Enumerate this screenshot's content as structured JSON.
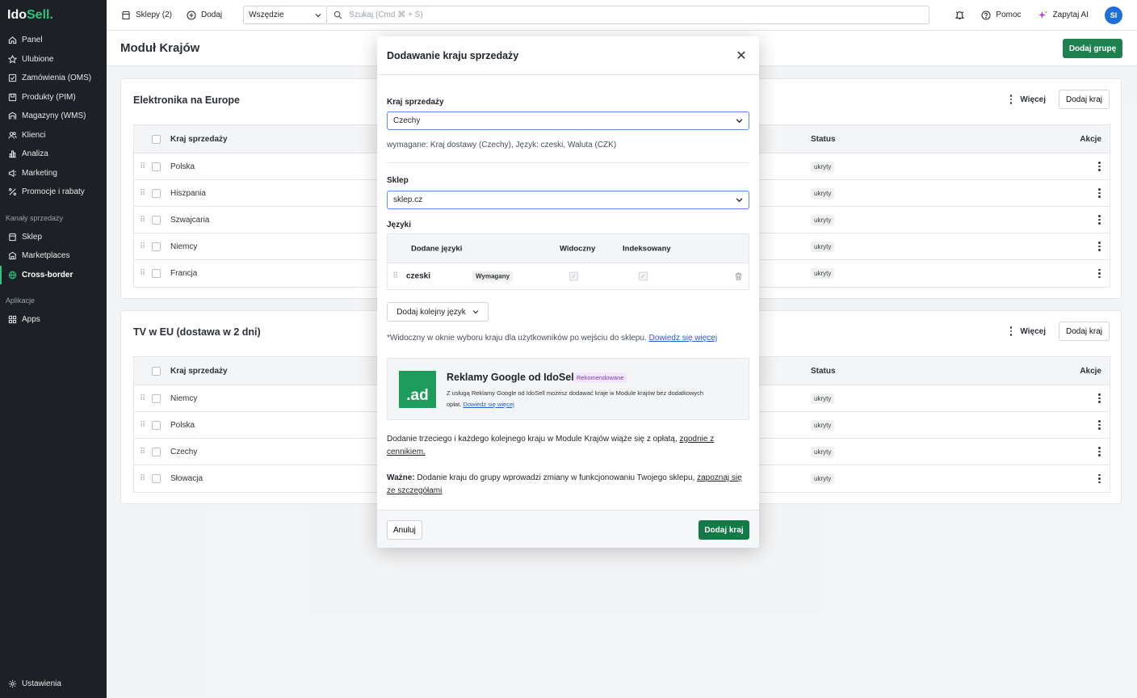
{
  "app": {
    "logo_part1": "Ido",
    "logo_part2": "Sell."
  },
  "sidebar": {
    "items": [
      {
        "label": "Panel",
        "icon": "home-icon"
      },
      {
        "label": "Ulubione",
        "icon": "star-icon"
      },
      {
        "label": "Zamówienia (OMS)",
        "icon": "orders-icon"
      },
      {
        "label": "Produkty (PIM)",
        "icon": "products-icon"
      },
      {
        "label": "Magazyny (WMS)",
        "icon": "warehouse-icon"
      },
      {
        "label": "Klienci",
        "icon": "users-icon"
      },
      {
        "label": "Analiza",
        "icon": "chart-icon"
      },
      {
        "label": "Marketing",
        "icon": "megaphone-icon"
      },
      {
        "label": "Promocje i rabaty",
        "icon": "percent-icon"
      }
    ],
    "section_sales": "Kanały sprzedaży",
    "sales_items": [
      {
        "label": "Sklep",
        "icon": "shop-icon"
      },
      {
        "label": "Marketplaces",
        "icon": "marketplace-icon"
      },
      {
        "label": "Cross-border",
        "icon": "globe-icon",
        "active": true
      }
    ],
    "section_apps": "Aplikacje",
    "apps_items": [
      {
        "label": "Apps",
        "icon": "apps-icon"
      }
    ],
    "settings": "Ustawienia"
  },
  "topbar": {
    "shops": "Sklepy (2)",
    "add": "Dodaj",
    "scope": "Wszędzie",
    "search_placeholder": "Szukaj (Cmd ⌘ + S)",
    "help": "Pomoc",
    "ask_ai": "Zapytaj AI",
    "avatar": "SI"
  },
  "page": {
    "title": "Moduł Krajów",
    "add_group": "Dodaj grupę"
  },
  "groups": [
    {
      "title": "Elektronika na Europe",
      "more": "Więcej",
      "add_country": "Dodaj kraj",
      "col_country": "Kraj sprzedaży",
      "col_status": "Status",
      "col_actions": "Akcje",
      "rows": [
        {
          "name": "Polska",
          "status": "ukryty"
        },
        {
          "name": "Hiszpania",
          "status": "ukryty"
        },
        {
          "name": "Szwajcaria",
          "status": "ukryty"
        },
        {
          "name": "Niemcy",
          "status": "ukryty"
        },
        {
          "name": "Francja",
          "status": "ukryty"
        }
      ]
    },
    {
      "title": "TV w EU (dostawa w 2 dni)",
      "more": "Więcej",
      "add_country": "Dodaj kraj",
      "col_country": "Kraj sprzedaży",
      "col_status": "Status",
      "col_actions": "Akcje",
      "rows": [
        {
          "name": "Niemcy",
          "status": "ukryty"
        },
        {
          "name": "Polska",
          "status": "ukryty"
        },
        {
          "name": "Czechy",
          "status": "ukryty"
        },
        {
          "name": "Słowacja",
          "status": "ukryty"
        }
      ]
    }
  ],
  "modal": {
    "title": "Dodawanie kraju sprzedaży",
    "country_label": "Kraj sprzedaży",
    "country_value": "Czechy",
    "required_prefix": "wymagane:",
    "required_text": " Kraj dostawy (Czechy), Język: czeski, Waluta (CZK)",
    "shop_label": "Sklep",
    "shop_value": "sklep.cz",
    "languages_label": "Języki",
    "lang_col_added": "Dodane języki",
    "lang_col_visible": "Widoczny",
    "lang_col_indexed": "Indeksowany",
    "lang_name": "czeski",
    "lang_required": "Wymagany",
    "add_language": "Dodaj kolejny język",
    "visible_note": "*Widoczny w oknie wyboru kraju dla użytkowników po wejściu do sklepu.",
    "learn_more": "Dowiedz się więcej",
    "promo": {
      "logo": ".ad",
      "title": "Reklamy Google od IdoSell",
      "badge": "Rekomendowane",
      "text": "Z usługą Reklamy Google od IdoSell możesz dodawać kraje w Module krajów bez dodatkowych opłat.",
      "link": "Dowiedz się więcej"
    },
    "fee_text": "Dodanie trzeciego i każdego kolejnego kraju w Module Krajów wiąże się z opłatą,",
    "fee_link": "zgodnie z cennikiem.",
    "important_label": "Ważne:",
    "important_text": " Dodanie kraju do grupy wprowadzi zmiany w funkcjonowaniu Twojego sklepu,",
    "important_link": "zapoznaj się ze szczegółami",
    "cancel": "Anuluj",
    "submit": "Dodaj kraj"
  },
  "colors": {
    "primary": "#117a45",
    "brand_green": "#2bc480",
    "sidebar_bg": "#1d2125",
    "link": "#1f5fc8"
  }
}
